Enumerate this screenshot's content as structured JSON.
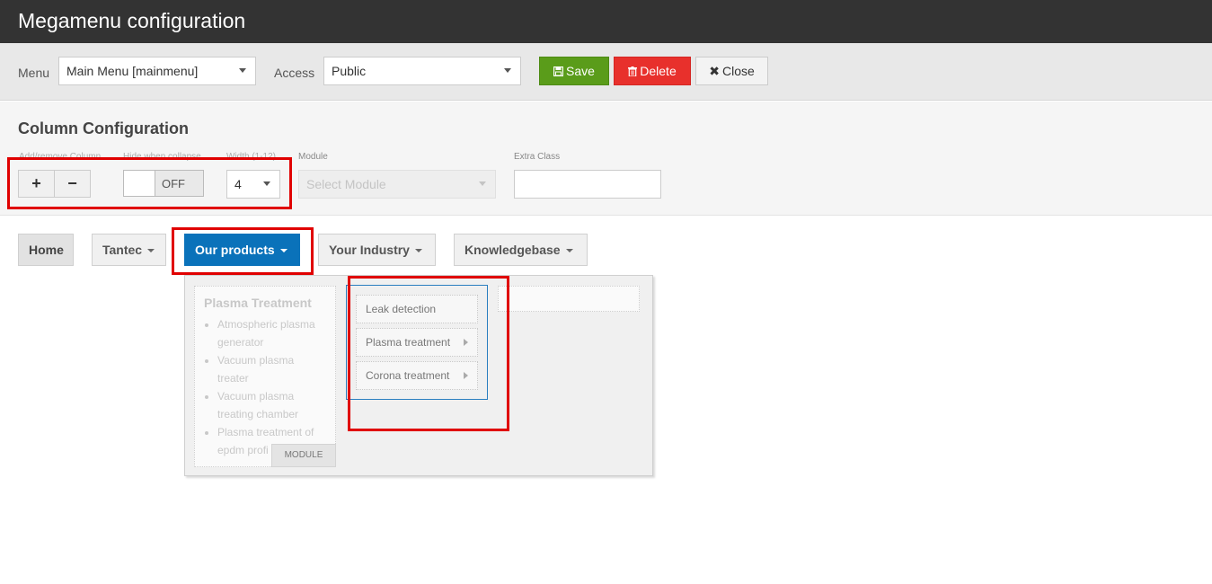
{
  "window": {
    "title": "Megamenu configuration"
  },
  "toolbar": {
    "menu_label": "Menu",
    "menu_value": "Main Menu [mainmenu]",
    "access_label": "Access",
    "access_value": "Public",
    "save_label": "Save",
    "delete_label": "Delete",
    "close_label": "Close"
  },
  "column_config": {
    "heading": "Column Configuration",
    "add_remove_label": "Add/remove Column",
    "add_symbol": "+",
    "remove_symbol": "−",
    "hide_label": "Hide when collapse",
    "hide_state": "OFF",
    "width_label": "Width (1-12)",
    "width_value": "4",
    "module_label": "Module",
    "module_placeholder": "Select Module",
    "extra_class_label": "Extra Class",
    "extra_class_value": ""
  },
  "nav": {
    "items": [
      {
        "label": "Home"
      },
      {
        "label": "Tantec"
      },
      {
        "label": "Our products"
      },
      {
        "label": "Your Industry"
      },
      {
        "label": "Knowledgebase"
      }
    ]
  },
  "dropdown": {
    "module_column": {
      "title": "Plasma Treatment",
      "items": [
        "Atmospheric plasma generator",
        "Vacuum plasma treater",
        "Vacuum plasma treating chamber",
        "Plasma treatment of epdm profi"
      ],
      "tag": "MODULE"
    },
    "menu_items": [
      {
        "label": "Leak detection"
      },
      {
        "label": "Plasma treatment"
      },
      {
        "label": "Corona treatment"
      }
    ]
  },
  "colors": {
    "titlebar": "#333333",
    "save": "#5a9c1a",
    "delete": "#e8302c",
    "active_nav": "#0a72ba",
    "highlight": "#e00000"
  },
  "icons": {
    "save": "floppy-icon",
    "delete": "trash-icon",
    "close": "close-icon"
  }
}
